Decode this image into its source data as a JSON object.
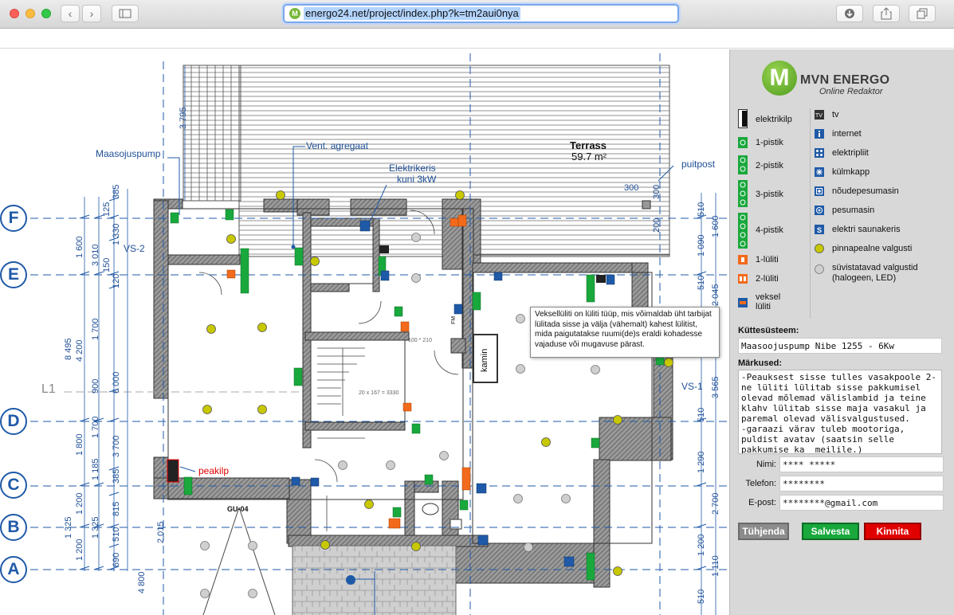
{
  "browser": {
    "url": "energo24.net/project/index.php?k=tm2aui0nya"
  },
  "plan": {
    "grid_labels": [
      "F",
      "E",
      "D",
      "C",
      "B",
      "A"
    ],
    "labels": {
      "maasojuspump": "Maasojuspump",
      "vent": "Vent. agregaat",
      "elektrikeris": "Elektrikeris",
      "elektrikeris2": "kuni 3kW",
      "terrass": "Terrass",
      "terrass_area": "59.7 m²",
      "puitpost": "puitpost",
      "vs2": "VS-2",
      "vs1": "VS-1",
      "l1": "L1",
      "kamin": "kamin",
      "peakilp": "peakilp",
      "gu04": "GU-04",
      "stair": "20 x 167 = 3330",
      "opening": "100 * 210",
      "fm": "FM"
    },
    "dims_left": [
      "3 795",
      "385",
      "125",
      "1 600",
      "1 330",
      "150",
      "3 010",
      "120",
      "1 700",
      "8 495",
      "4 200",
      "900",
      "6 000",
      "1 700",
      "1 800",
      "1 185",
      "385",
      "3 700",
      "1 325",
      "1 200",
      "815",
      "1 325",
      "510",
      "2 015",
      "1 200",
      "690",
      "4 800"
    ],
    "dims_right": [
      "300",
      "300",
      "200",
      "510",
      "1 090",
      "1 600",
      "510",
      "2 045",
      "3 565",
      "510",
      "1 290",
      "2 700",
      "1 200",
      "1 110",
      "510"
    ],
    "tooltip": "Veksellüliti on lüliti tüüp, mis võimaldab üht tarbijat lülitada sisse ja välja (vähemalt) kahest lülitist, mida paigutatakse ruumi(de)s eraldi kohadesse vajaduse või mugavuse pärast."
  },
  "panel": {
    "logo_title": "MVN ENERGO",
    "logo_sub": "Online Redaktor",
    "logo_mark": "M",
    "legend_left": [
      {
        "label": "elektrikilp",
        "icon": "panel-icon"
      },
      {
        "label": "1-pistik",
        "icon": "socket-1-icon"
      },
      {
        "label": "2-pistik",
        "icon": "socket-2-icon"
      },
      {
        "label": "3-pistik",
        "icon": "socket-3-icon"
      },
      {
        "label": "4-pistik",
        "icon": "socket-4-icon"
      },
      {
        "label": "1-lüliti",
        "icon": "switch-1-icon"
      },
      {
        "label": "2-lüliti",
        "icon": "switch-2-icon"
      },
      {
        "label": "veksel\nlüliti",
        "icon": "switch-veksel-icon"
      }
    ],
    "legend_right": [
      {
        "label": "tv",
        "icon": "tv-icon"
      },
      {
        "label": "internet",
        "icon": "internet-icon"
      },
      {
        "label": "elektripliit",
        "icon": "stove-icon"
      },
      {
        "label": "külmkapp",
        "icon": "fridge-icon"
      },
      {
        "label": "nõudepesumasin",
        "icon": "dishwasher-icon"
      },
      {
        "label": "pesumasin",
        "icon": "washer-icon"
      },
      {
        "label": "elektri saunakeris",
        "icon": "sauna-icon"
      },
      {
        "label": "pinnapealne valgusti",
        "icon": "surface-light-icon"
      },
      {
        "label": "süvistatavad valgustid\n(halogeen, LED)",
        "icon": "recessed-light-icon"
      }
    ],
    "kuttesusteem_label": "Küttesüsteem:",
    "kuttesusteem_value": "Maasoojuspump Nibe 1255 - 6Kw",
    "markused_label": "Märkused:",
    "markused_value": "-Peauksest sisse tulles vasakpoole 2-ne lüliti lülitab sisse pakkumisel olevad mõlemad välislambid ja teine klahv lülitab sisse maja vasakul ja paremal olevad välisvalgustused.\n-garaazi värav tuleb mootoriga, puldist avatav (saatsin selle pakkumise ka  meilile.)\n-Välis värav tuleb elektrimootoriga ja puldist avatav.",
    "nimi_label": "Nimi:",
    "nimi_value": "**** *****",
    "telefon_label": "Telefon:",
    "telefon_value": "********",
    "epost_label": "E-post:",
    "epost_value": "********@gmail.com",
    "btn_clear": "Tühjenda",
    "btn_save": "Salvesta",
    "btn_confirm": "Kinnita",
    "colors": {
      "green": "#19a83c",
      "red": "#e00000",
      "orange": "#f26a1b",
      "blue": "#1f5aa8",
      "light": "#c8c800"
    }
  }
}
